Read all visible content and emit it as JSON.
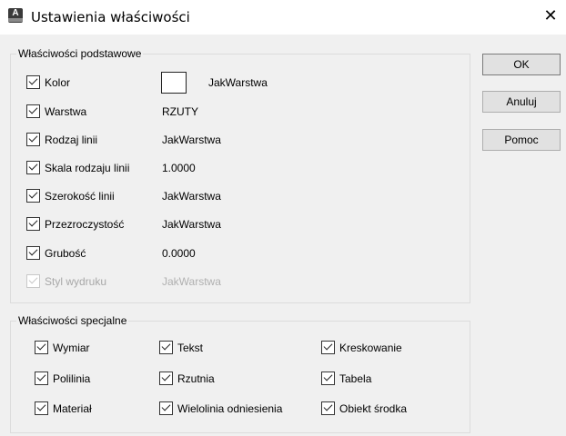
{
  "window": {
    "title": "Ustawienia właściwości",
    "close_glyph": "✕"
  },
  "basic": {
    "title": "Właściwości podstawowe",
    "items": [
      {
        "label": "Kolor",
        "value": "JakWarstwa",
        "checked": true
      },
      {
        "label": "Warstwa",
        "value": "RZUTY",
        "checked": true
      },
      {
        "label": "Rodzaj linii",
        "value": "JakWarstwa",
        "checked": true
      },
      {
        "label": "Skala rodzaju linii",
        "value": "1.0000",
        "checked": true
      },
      {
        "label": "Szerokość linii",
        "value": "JakWarstwa",
        "checked": true
      },
      {
        "label": "Przezroczystość",
        "value": "JakWarstwa",
        "checked": true
      },
      {
        "label": "Grubość",
        "value": "0.0000",
        "checked": true
      },
      {
        "label": "Styl wydruku",
        "value": "JakWarstwa",
        "checked": true,
        "disabled": true
      }
    ]
  },
  "special": {
    "title": "Właściwości specjalne",
    "items": [
      {
        "label": "Wymiar",
        "checked": true
      },
      {
        "label": "Tekst",
        "checked": true
      },
      {
        "label": "Kreskowanie",
        "checked": true
      },
      {
        "label": "Polilinia",
        "checked": true
      },
      {
        "label": "Rzutnia",
        "checked": true
      },
      {
        "label": "Tabela",
        "checked": true
      },
      {
        "label": "Materiał",
        "checked": true
      },
      {
        "label": "Wielolinia odniesienia",
        "checked": true
      },
      {
        "label": "Obiekt środka",
        "checked": true
      }
    ]
  },
  "buttons": {
    "ok": "OK",
    "cancel": "Anuluj",
    "help": "Pomoc"
  },
  "colors": {
    "swatch": "#ffffff"
  }
}
